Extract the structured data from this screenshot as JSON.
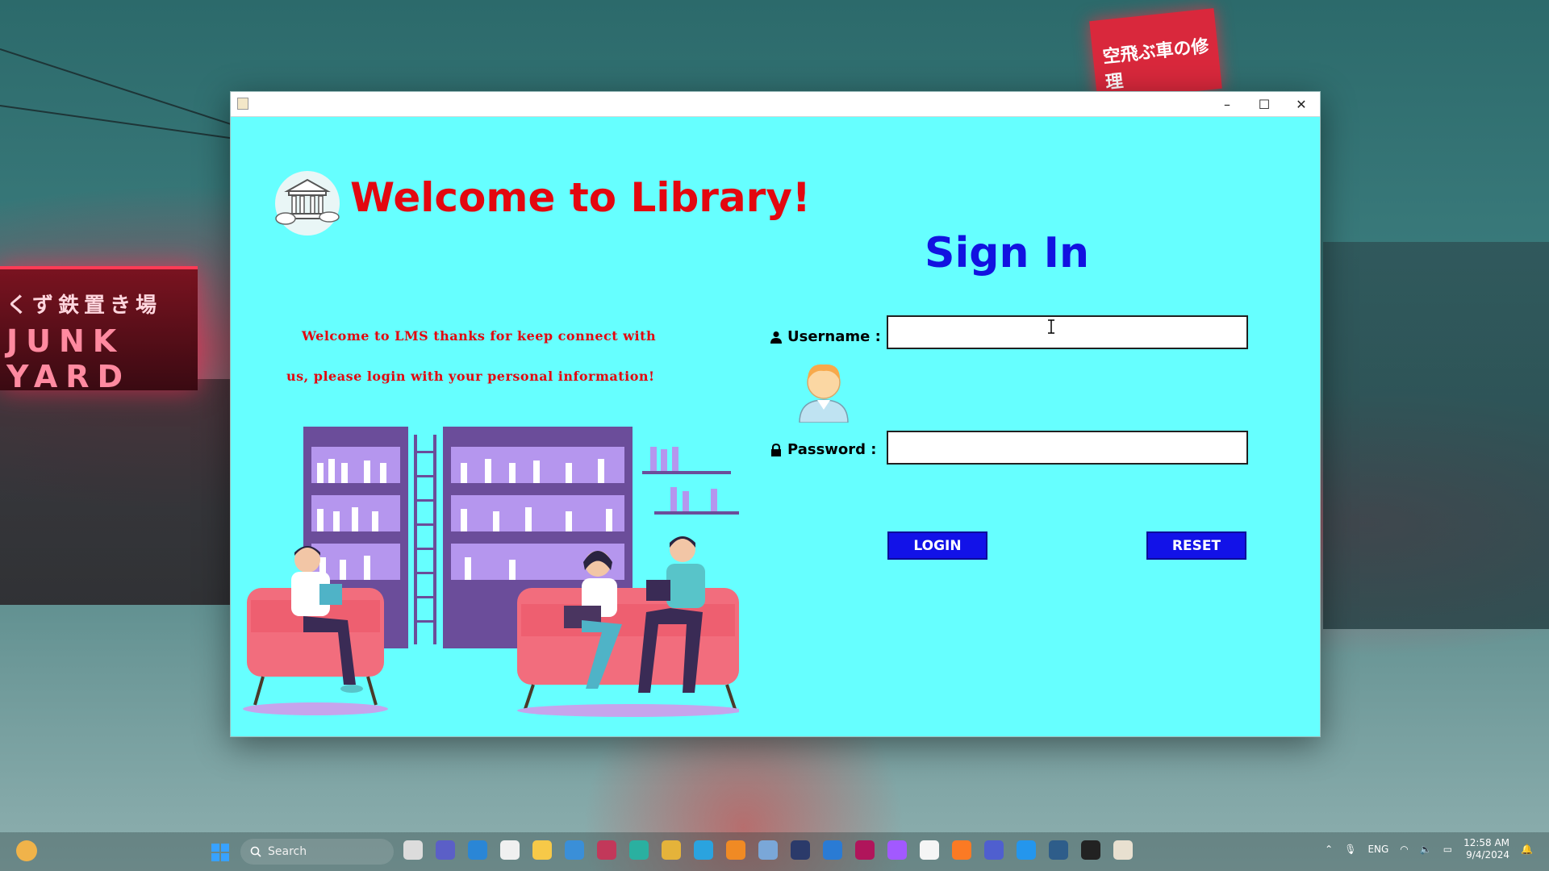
{
  "window": {
    "controls": {
      "minimize": "–",
      "maximize": "☐",
      "close": "✕"
    }
  },
  "app": {
    "welcome_title": "Welcome to Library!",
    "signin_title": "Sign In",
    "intro_line1": "Welcome to LMS thanks for keep connect with",
    "intro_line2": "us, please login with your personal information!",
    "username_label": "Username :",
    "password_label": "Password :",
    "username_value": "",
    "password_value": "",
    "login_label": "LOGIN",
    "reset_label": "RESET"
  },
  "colors": {
    "window_bg": "#66ffff",
    "title_red": "#e3070f",
    "signin_blue": "#1212e0",
    "button_blue": "#1212e8"
  },
  "background": {
    "left_sign_jp": "くず鉄置き場",
    "left_sign_neon": "JUNK YARD",
    "right_sign_jp": "空飛ぶ車の修理"
  },
  "taskbar": {
    "search_placeholder": "Search",
    "language": "ENG",
    "time": "12:58 AM",
    "date": "9/4/2024"
  }
}
